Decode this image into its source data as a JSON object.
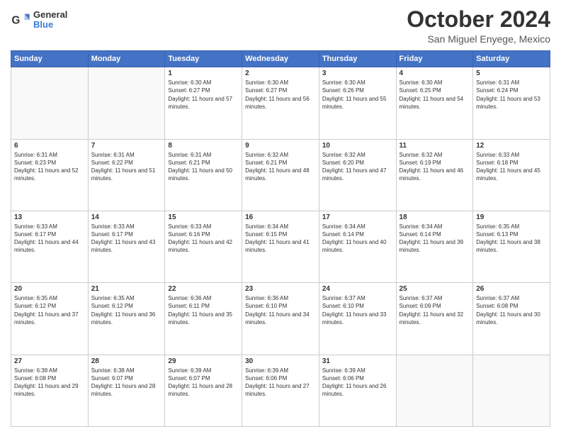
{
  "header": {
    "logo_general": "General",
    "logo_blue": "Blue",
    "month_title": "October 2024",
    "location": "San Miguel Enyege, Mexico"
  },
  "weekdays": [
    "Sunday",
    "Monday",
    "Tuesday",
    "Wednesday",
    "Thursday",
    "Friday",
    "Saturday"
  ],
  "weeks": [
    [
      {
        "day": "",
        "info": ""
      },
      {
        "day": "",
        "info": ""
      },
      {
        "day": "1",
        "info": "Sunrise: 6:30 AM\nSunset: 6:27 PM\nDaylight: 11 hours and 57 minutes."
      },
      {
        "day": "2",
        "info": "Sunrise: 6:30 AM\nSunset: 6:27 PM\nDaylight: 11 hours and 56 minutes."
      },
      {
        "day": "3",
        "info": "Sunrise: 6:30 AM\nSunset: 6:26 PM\nDaylight: 11 hours and 55 minutes."
      },
      {
        "day": "4",
        "info": "Sunrise: 6:30 AM\nSunset: 6:25 PM\nDaylight: 11 hours and 54 minutes."
      },
      {
        "day": "5",
        "info": "Sunrise: 6:31 AM\nSunset: 6:24 PM\nDaylight: 11 hours and 53 minutes."
      }
    ],
    [
      {
        "day": "6",
        "info": "Sunrise: 6:31 AM\nSunset: 6:23 PM\nDaylight: 11 hours and 52 minutes."
      },
      {
        "day": "7",
        "info": "Sunrise: 6:31 AM\nSunset: 6:22 PM\nDaylight: 11 hours and 51 minutes."
      },
      {
        "day": "8",
        "info": "Sunrise: 6:31 AM\nSunset: 6:21 PM\nDaylight: 11 hours and 50 minutes."
      },
      {
        "day": "9",
        "info": "Sunrise: 6:32 AM\nSunset: 6:21 PM\nDaylight: 11 hours and 48 minutes."
      },
      {
        "day": "10",
        "info": "Sunrise: 6:32 AM\nSunset: 6:20 PM\nDaylight: 11 hours and 47 minutes."
      },
      {
        "day": "11",
        "info": "Sunrise: 6:32 AM\nSunset: 6:19 PM\nDaylight: 11 hours and 46 minutes."
      },
      {
        "day": "12",
        "info": "Sunrise: 6:33 AM\nSunset: 6:18 PM\nDaylight: 11 hours and 45 minutes."
      }
    ],
    [
      {
        "day": "13",
        "info": "Sunrise: 6:33 AM\nSunset: 6:17 PM\nDaylight: 11 hours and 44 minutes."
      },
      {
        "day": "14",
        "info": "Sunrise: 6:33 AM\nSunset: 6:17 PM\nDaylight: 11 hours and 43 minutes."
      },
      {
        "day": "15",
        "info": "Sunrise: 6:33 AM\nSunset: 6:16 PM\nDaylight: 11 hours and 42 minutes."
      },
      {
        "day": "16",
        "info": "Sunrise: 6:34 AM\nSunset: 6:15 PM\nDaylight: 11 hours and 41 minutes."
      },
      {
        "day": "17",
        "info": "Sunrise: 6:34 AM\nSunset: 6:14 PM\nDaylight: 11 hours and 40 minutes."
      },
      {
        "day": "18",
        "info": "Sunrise: 6:34 AM\nSunset: 6:14 PM\nDaylight: 11 hours and 39 minutes."
      },
      {
        "day": "19",
        "info": "Sunrise: 6:35 AM\nSunset: 6:13 PM\nDaylight: 11 hours and 38 minutes."
      }
    ],
    [
      {
        "day": "20",
        "info": "Sunrise: 6:35 AM\nSunset: 6:12 PM\nDaylight: 11 hours and 37 minutes."
      },
      {
        "day": "21",
        "info": "Sunrise: 6:35 AM\nSunset: 6:12 PM\nDaylight: 11 hours and 36 minutes."
      },
      {
        "day": "22",
        "info": "Sunrise: 6:36 AM\nSunset: 6:11 PM\nDaylight: 11 hours and 35 minutes."
      },
      {
        "day": "23",
        "info": "Sunrise: 6:36 AM\nSunset: 6:10 PM\nDaylight: 11 hours and 34 minutes."
      },
      {
        "day": "24",
        "info": "Sunrise: 6:37 AM\nSunset: 6:10 PM\nDaylight: 11 hours and 33 minutes."
      },
      {
        "day": "25",
        "info": "Sunrise: 6:37 AM\nSunset: 6:09 PM\nDaylight: 11 hours and 32 minutes."
      },
      {
        "day": "26",
        "info": "Sunrise: 6:37 AM\nSunset: 6:08 PM\nDaylight: 11 hours and 30 minutes."
      }
    ],
    [
      {
        "day": "27",
        "info": "Sunrise: 6:38 AM\nSunset: 6:08 PM\nDaylight: 11 hours and 29 minutes."
      },
      {
        "day": "28",
        "info": "Sunrise: 6:38 AM\nSunset: 6:07 PM\nDaylight: 11 hours and 28 minutes."
      },
      {
        "day": "29",
        "info": "Sunrise: 6:39 AM\nSunset: 6:07 PM\nDaylight: 11 hours and 28 minutes."
      },
      {
        "day": "30",
        "info": "Sunrise: 6:39 AM\nSunset: 6:06 PM\nDaylight: 11 hours and 27 minutes."
      },
      {
        "day": "31",
        "info": "Sunrise: 6:39 AM\nSunset: 6:06 PM\nDaylight: 11 hours and 26 minutes."
      },
      {
        "day": "",
        "info": ""
      },
      {
        "day": "",
        "info": ""
      }
    ]
  ]
}
